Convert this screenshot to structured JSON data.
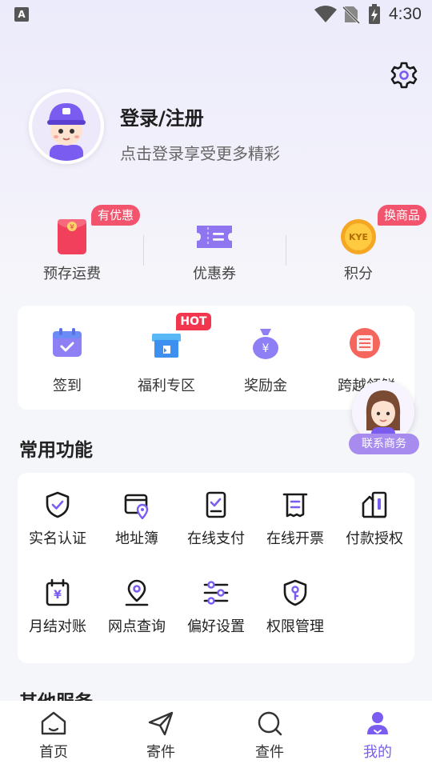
{
  "status_bar": {
    "time": "4:30",
    "app_icon_letter": "A"
  },
  "header": {
    "login_title": "登录/注册",
    "login_subtitle": "点击登录享受更多精彩"
  },
  "assets": [
    {
      "label": "预存运费",
      "badge": "有优惠",
      "icon": "red-envelope-icon"
    },
    {
      "label": "优惠券",
      "icon": "coupon-icon"
    },
    {
      "label": "积分",
      "badge": "换商品",
      "icon": "coin-icon",
      "coin_text": "KYE"
    }
  ],
  "quick_actions": [
    {
      "label": "签到",
      "icon": "calendar-check-icon"
    },
    {
      "label": "福利专区",
      "icon": "gift-box-icon",
      "badge": "HOT"
    },
    {
      "label": "奖励金",
      "icon": "money-bag-icon"
    },
    {
      "label": "跨越领鲜",
      "icon": "fresh-logo-icon"
    }
  ],
  "contact": {
    "label": "联系商务"
  },
  "common_functions": {
    "title": "常用功能",
    "items": [
      {
        "label": "实名认证",
        "icon": "shield-check-icon"
      },
      {
        "label": "地址簿",
        "icon": "address-book-icon"
      },
      {
        "label": "在线支付",
        "icon": "payment-doc-icon"
      },
      {
        "label": "在线开票",
        "icon": "invoice-icon"
      },
      {
        "label": "付款授权",
        "icon": "payment-auth-icon"
      },
      {
        "label": "月结对账",
        "icon": "monthly-bill-icon"
      },
      {
        "label": "网点查询",
        "icon": "location-pin-icon"
      },
      {
        "label": "偏好设置",
        "icon": "sliders-icon"
      },
      {
        "label": "权限管理",
        "icon": "shield-key-icon"
      }
    ]
  },
  "other_services": {
    "title": "其他服务"
  },
  "bottom_nav": [
    {
      "label": "首页",
      "icon": "home-icon"
    },
    {
      "label": "寄件",
      "icon": "send-icon"
    },
    {
      "label": "查件",
      "icon": "search-package-icon"
    },
    {
      "label": "我的",
      "icon": "profile-icon",
      "active": true
    }
  ],
  "colors": {
    "accent": "#7b5cf0",
    "badge_red": "#f2546d",
    "hot_red": "#f2364e",
    "contact_purple": "#a78bef"
  }
}
